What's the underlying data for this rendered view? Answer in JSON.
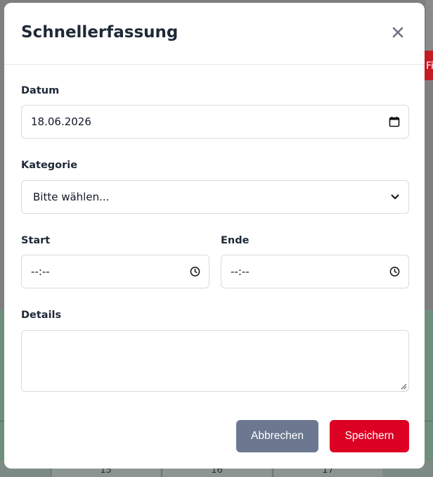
{
  "background": {
    "edge_button_label": "Fi",
    "day_cells": [
      "15",
      "16",
      "17"
    ]
  },
  "modal": {
    "title": "Schnellerfassung",
    "close_icon": "close-icon"
  },
  "form": {
    "date": {
      "label": "Datum",
      "value": "18.06.2026",
      "icon": "calendar-icon"
    },
    "category": {
      "label": "Kategorie",
      "selected": "Bitte wählen...",
      "icon": "chevron-down-icon"
    },
    "start": {
      "label": "Start",
      "value": "--:--",
      "icon": "clock-icon"
    },
    "end": {
      "label": "Ende",
      "value": "--:--",
      "icon": "clock-icon"
    },
    "details": {
      "label": "Details",
      "value": ""
    }
  },
  "buttons": {
    "cancel": "Abbrechen",
    "save": "Speichern"
  },
  "colors": {
    "primary": "#dc0022",
    "secondary": "#6b7890",
    "text": "#1f2937",
    "border": "#d7dbe0"
  }
}
